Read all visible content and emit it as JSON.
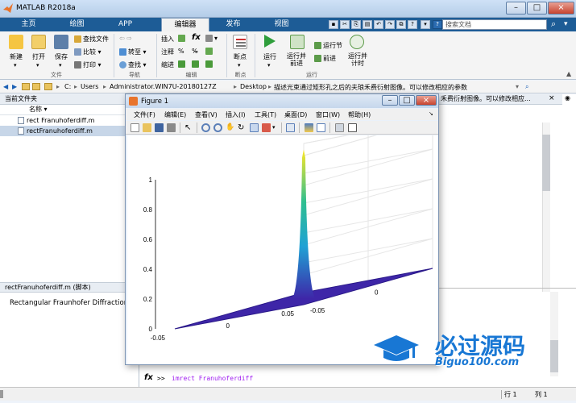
{
  "app": {
    "title": "MATLAB R2018a",
    "min": "–",
    "max": "□",
    "close": "×"
  },
  "tabs": [
    "主页",
    "绘图",
    "APP",
    "编辑器",
    "发布",
    "视图"
  ],
  "search": {
    "placeholder": "搜索文档"
  },
  "ribbon": {
    "file": {
      "new": "新建",
      "open": "打开",
      "save": "保存",
      "find_file": "查找文件",
      "compare": "比较",
      "print": "打印",
      "group": "文件"
    },
    "nav": {
      "goto": "转至",
      "find": "查找",
      "group": "导航"
    },
    "edit": {
      "insert": "插入",
      "comment": "注释",
      "indent": "缩进",
      "fx": "fx",
      "group": "编辑"
    },
    "breakpoints": {
      "label": "断点",
      "group": "断点"
    },
    "run": {
      "run": "运行",
      "run_advance": "运行并\n前进",
      "run_section": "运行节",
      "advance": "前进",
      "run_time": "运行并\n计时",
      "group": "运行"
    }
  },
  "address": {
    "path": [
      "C:",
      "Users",
      "Administrator.WIN7U-20180127Z",
      "Desktop",
      "描述光束通过矩形孔之后的夫琅禾费衍射图像。可以修改相应的参数"
    ],
    "right_text": "禾费衍射图像。可以修改相应..."
  },
  "current_folder": {
    "title": "当前文件夹",
    "col_name": "名称 ▾",
    "files": [
      "rect Franuhoferdiff.m",
      "rectFranuhoferdiff.m"
    ]
  },
  "details": {
    "title": "rectFranuhoferdiff.m  (脚本)",
    "description": "Rectangular Fraunhofer Diffraction"
  },
  "command": {
    "prompt": ">> ",
    "text": "imrect Franuhoferdiff",
    "fx": "fx"
  },
  "status": {
    "row": "行 1",
    "col": "列 1"
  },
  "figure": {
    "title": "Figure 1",
    "menu": [
      "文件(F)",
      "编辑(E)",
      "查看(V)",
      "插入(I)",
      "工具(T)",
      "桌面(D)",
      "窗口(W)",
      "帮助(H)"
    ],
    "z_ticks": [
      "0",
      "0.2",
      "0.4",
      "0.6",
      "0.8",
      "1"
    ],
    "x_ticks": [
      "0.05",
      "0",
      "-0.05"
    ],
    "y_ticks": [
      "0.05",
      "0",
      "-0.05"
    ]
  },
  "watermark": {
    "name": "必过源码",
    "url": "Biguo100.com"
  },
  "chart_data": {
    "type": "surface",
    "title": "",
    "xlabel": "",
    "ylabel": "",
    "zlabel": "",
    "xlim": [
      -0.05,
      0.05
    ],
    "ylim": [
      -0.05,
      0.05
    ],
    "zlim": [
      0,
      1
    ],
    "peak": {
      "x": 0,
      "y": 0,
      "z": 1
    },
    "base_color": "#3e26a8",
    "peak_color": "#fde725",
    "grid": true
  }
}
